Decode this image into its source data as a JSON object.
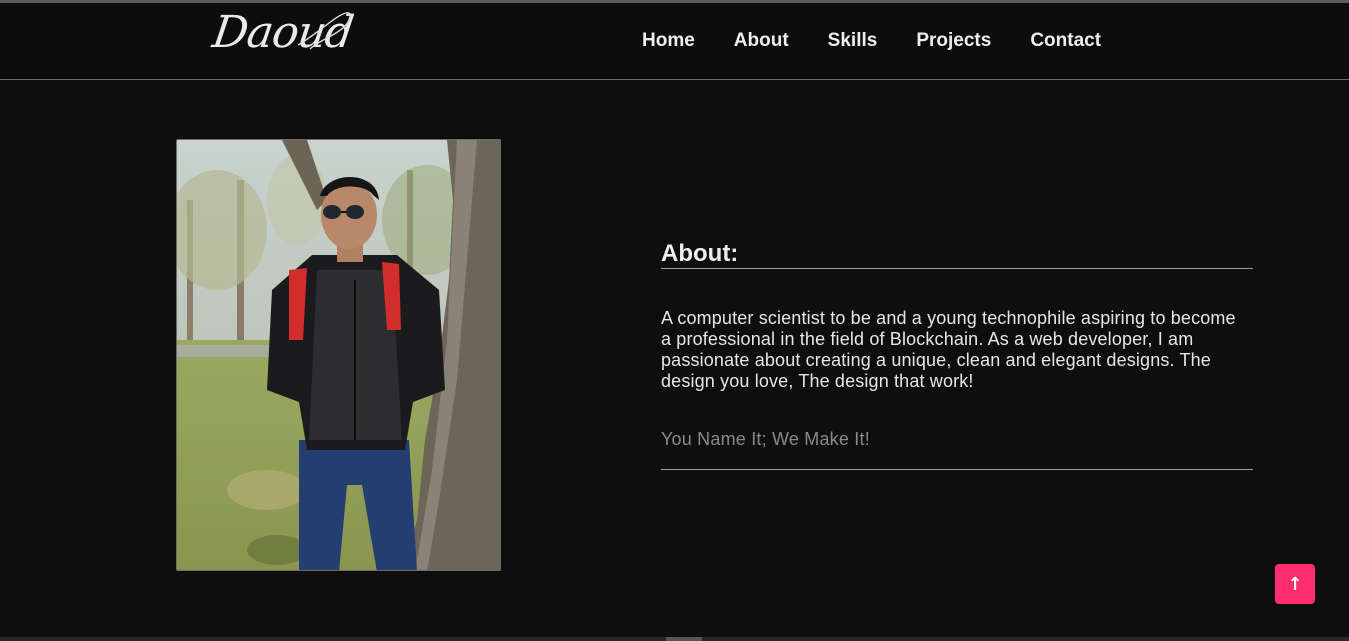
{
  "header": {
    "logo_text": "Daoud",
    "nav": [
      "Home",
      "About",
      "Skills",
      "Projects",
      "Contact"
    ]
  },
  "about": {
    "title": "About:",
    "text": "A computer scientist to be and a young technophile aspiring to become a professional in the field of Blockchain. As a web developer, I am passionate about creating a unique, clean and elegant designs. The design you love, The design that work!",
    "tagline": "You Name It; We Make It!"
  },
  "scroll_top": {
    "icon": "arrow-up-icon",
    "glyph": "↑"
  },
  "colors": {
    "background": "#0e0e0f",
    "accent": "#ff2d6f",
    "text": "#eeeeee",
    "muted": "#8a8a8a"
  }
}
